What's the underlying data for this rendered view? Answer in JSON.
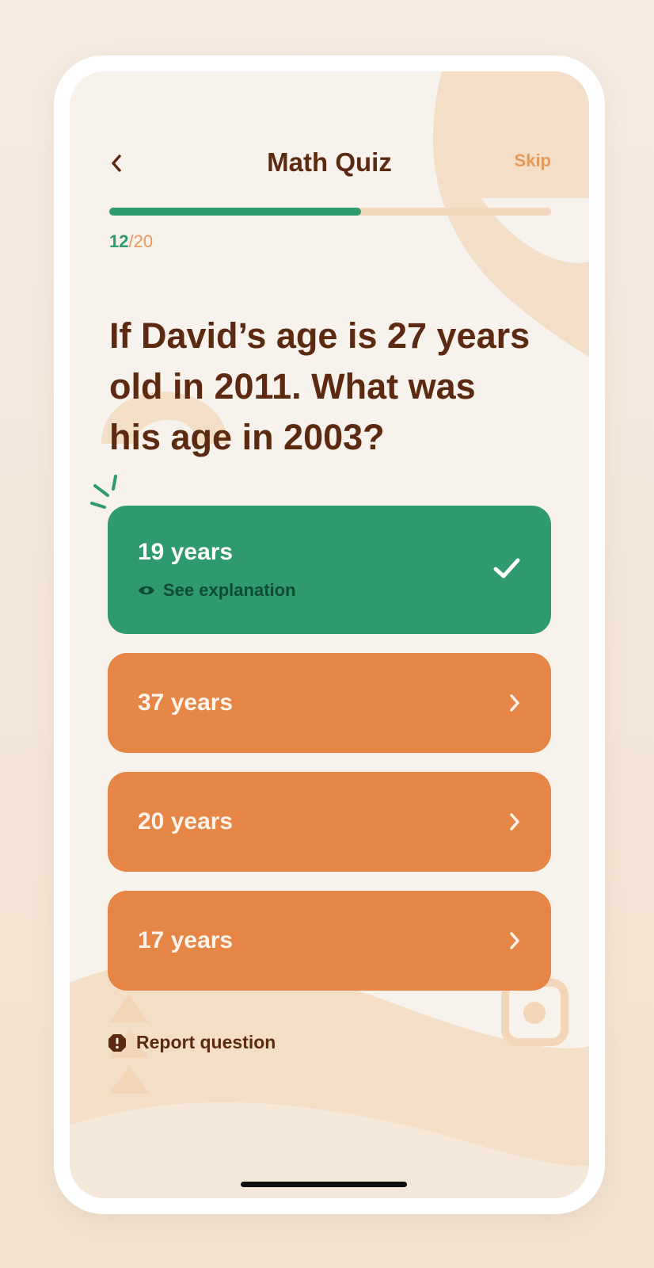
{
  "header": {
    "back_icon": "chevron-left-icon",
    "title": "Math Quiz",
    "skip_label": "Skip"
  },
  "progress": {
    "current": "12",
    "separator": "/",
    "total": "20",
    "fraction": 0.57
  },
  "question": {
    "text": "If David’s age is 27 years old in 2011. What was his age in 2003?"
  },
  "answers": [
    {
      "label": "19  years",
      "state": "correct",
      "explanation_label": "See explanation",
      "icon": "check-icon"
    },
    {
      "label": "37 years",
      "state": "default",
      "icon": "chevron-right-icon"
    },
    {
      "label": "20 years",
      "state": "default",
      "icon": "chevron-right-icon"
    },
    {
      "label": "17 years",
      "state": "default",
      "icon": "chevron-right-icon"
    }
  ],
  "footer": {
    "report_label": "Report question",
    "report_icon": "alert-icon"
  },
  "colors": {
    "accent_green": "#2e9a6e",
    "accent_orange": "#e58646",
    "text_brown": "#5b2a10",
    "skip_orange": "#e69a5a"
  }
}
